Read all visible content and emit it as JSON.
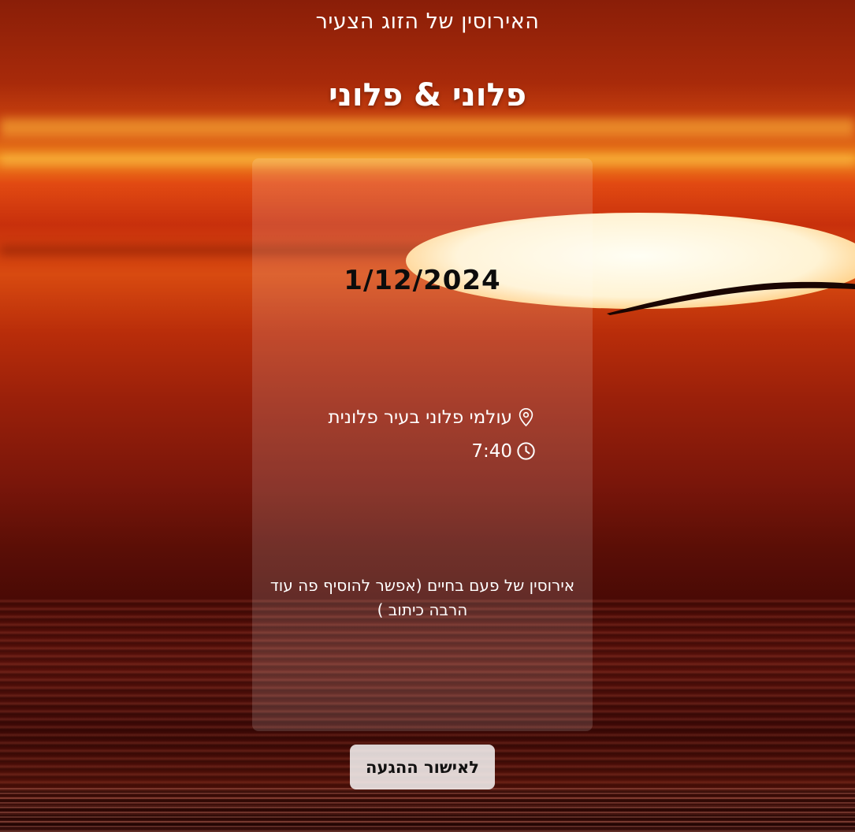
{
  "header": {
    "subtitle": "האירוסין של הזוג הצעיר",
    "names": "פלוני & פלוני"
  },
  "event": {
    "date": "1/12/2024",
    "location": "עולמי פלוני בעיר פלונית",
    "location_icon": "map-pin-icon",
    "time": "7:40",
    "time_icon": "clock-icon",
    "description": "אירוסין של פעם בחיים (אפשר להוסיף פה עוד הרבה כיתוב )"
  },
  "rsvp_button": {
    "label": "לאישור ההגעה"
  },
  "colors": {
    "text": "#ffffff",
    "date_text": "#0c0c0c",
    "button_bg": "#f2e6e4"
  }
}
